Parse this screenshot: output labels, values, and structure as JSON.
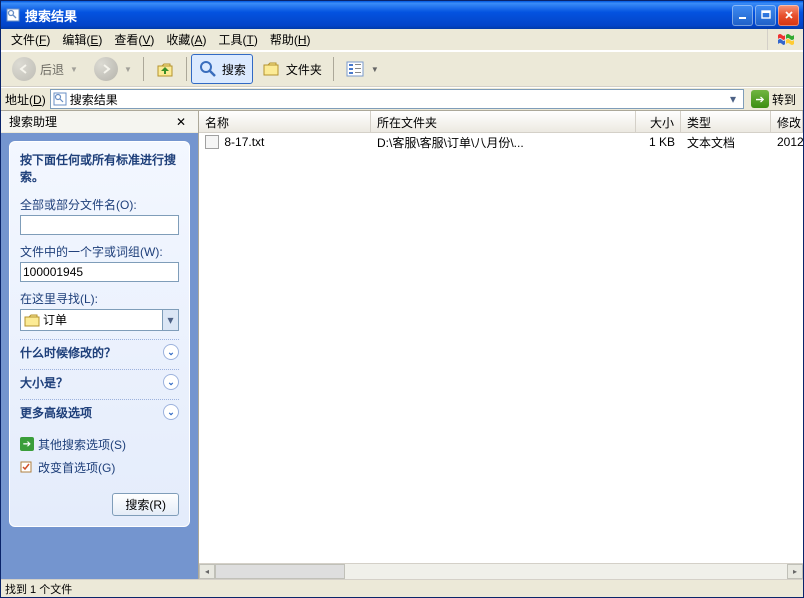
{
  "window": {
    "title": "搜索结果"
  },
  "menu": {
    "file": {
      "txt": "文件",
      "ak": "F"
    },
    "edit": {
      "txt": "编辑",
      "ak": "E"
    },
    "view": {
      "txt": "查看",
      "ak": "V"
    },
    "fav": {
      "txt": "收藏",
      "ak": "A"
    },
    "tools": {
      "txt": "工具",
      "ak": "T"
    },
    "help": {
      "txt": "帮助",
      "ak": "H"
    }
  },
  "toolbar": {
    "back": "后退",
    "search": "搜索",
    "folders": "文件夹"
  },
  "address": {
    "label": "地址",
    "ak": "D",
    "value": "搜索结果",
    "go": "转到"
  },
  "companion": {
    "title": "搜索助理",
    "heading": "按下面任何或所有标准进行搜索。",
    "filename_label": "全部或部分文件名(O):",
    "filename_value": "",
    "content_label": "文件中的一个字或词组(W):",
    "content_value": "100001945",
    "lookin_label": "在这里寻找(L):",
    "lookin_value": "订单",
    "exp_when": "什么时候修改的？",
    "exp_size": "大小是？",
    "exp_more": "更多高级选项",
    "other_search": "其他搜索选项(S)",
    "change_prefs": "改变首选项(G)",
    "search_btn": "搜索(R)"
  },
  "columns": {
    "name": "名称",
    "in_folder": "所在文件夹",
    "size": "大小",
    "type": "类型",
    "modified": "修改"
  },
  "col_widths": {
    "name": 172,
    "in_folder": 265,
    "size": 45,
    "type": 90,
    "modified": 60
  },
  "results": [
    {
      "name": "8-17.txt",
      "in_folder": "D:\\客服\\客服\\订单\\八月份\\...",
      "size": "1 KB",
      "type": "文本文档",
      "modified": "2012"
    }
  ],
  "status": "找到 1 个文件"
}
